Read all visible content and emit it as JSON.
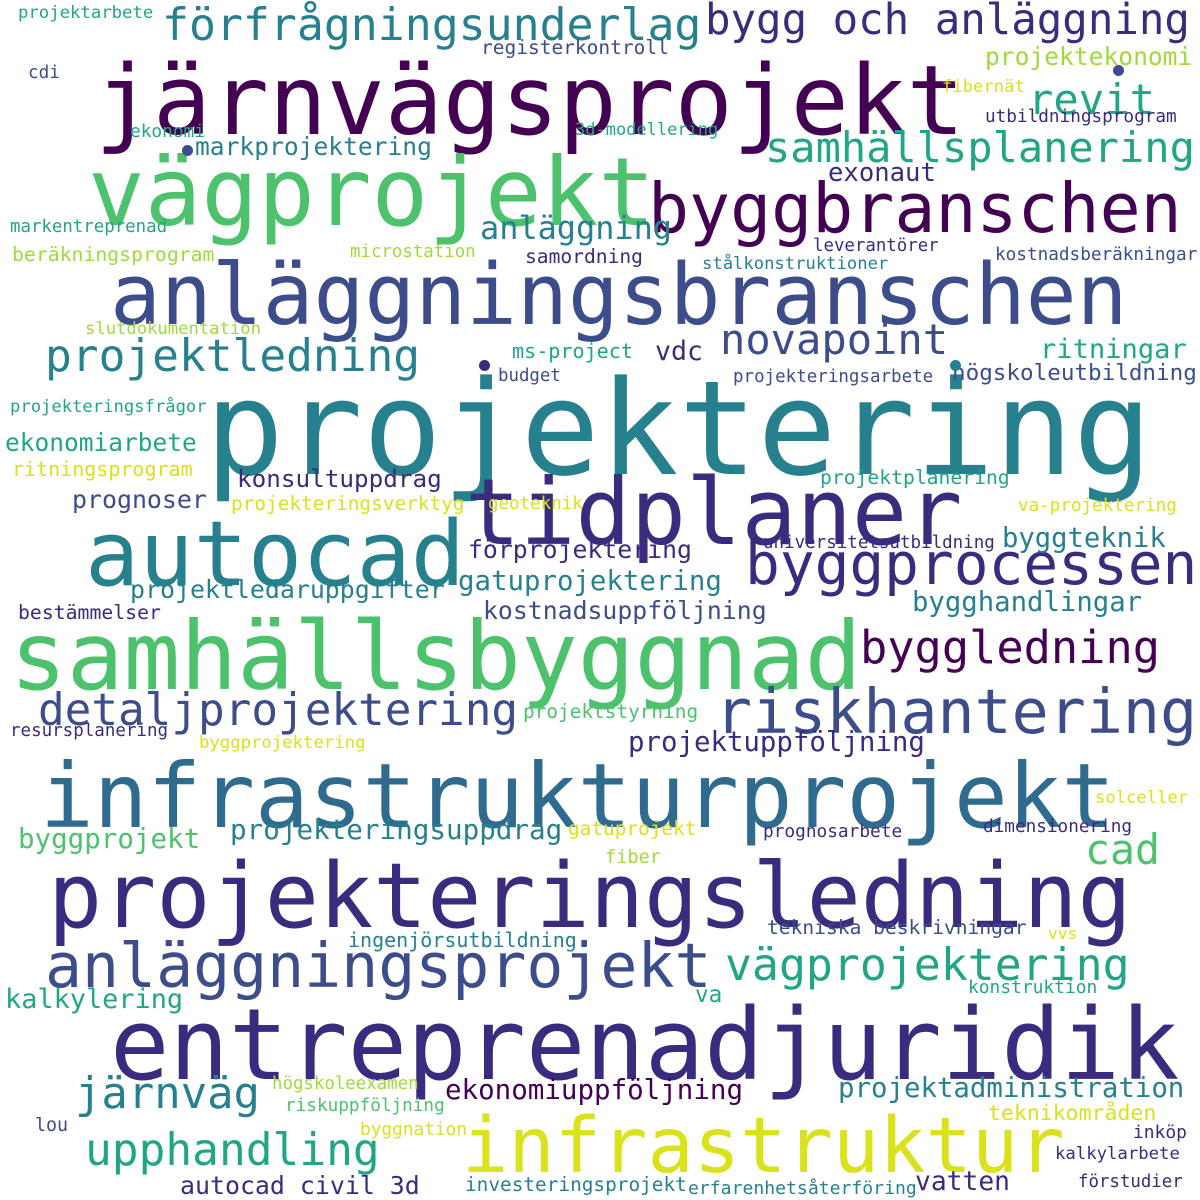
{
  "palette": {
    "dark_purple": "#440154",
    "indigo": "#3b2b7f",
    "slate_blue": "#3d4c8a",
    "steel_blue": "#2f6b8e",
    "teal": "#27808e",
    "sea_green": "#21a685",
    "green": "#4cc26c",
    "lime": "#a2d93a",
    "yellow": "#d9e21a"
  },
  "words": [
    {
      "text": "projektering"
    },
    {
      "text": "järnvägsprojekt"
    },
    {
      "text": "vägprojekt"
    },
    {
      "text": "anläggningsbranschen"
    },
    {
      "text": "samhällsbyggnad"
    },
    {
      "text": "infrastrukturprojekt"
    },
    {
      "text": "projekteringsledning"
    },
    {
      "text": "entreprenadjuridik"
    },
    {
      "text": "infrastruktur"
    },
    {
      "text": "autocad"
    },
    {
      "text": "tidplaner"
    },
    {
      "text": "byggbranschen"
    },
    {
      "text": "byggprocessen"
    },
    {
      "text": "riskhantering"
    },
    {
      "text": "anläggningsprojekt"
    },
    {
      "text": "förfrågningsunderlag"
    },
    {
      "text": "bygg och anläggning"
    },
    {
      "text": "byggledning"
    },
    {
      "text": "detaljprojektering"
    },
    {
      "text": "samhällsplanering"
    },
    {
      "text": "vägprojektering"
    },
    {
      "text": "upphandling"
    },
    {
      "text": "projektledning"
    },
    {
      "text": "novapoint"
    },
    {
      "text": "järnväg"
    },
    {
      "text": "revit"
    },
    {
      "text": "cad"
    },
    {
      "text": "anläggning"
    },
    {
      "text": "markprojektering"
    },
    {
      "text": "projekteringsuppdrag"
    },
    {
      "text": "ekonomiuppföljning"
    },
    {
      "text": "projektadministration"
    },
    {
      "text": "gatuprojektering"
    },
    {
      "text": "projektuppföljning"
    },
    {
      "text": "byggprojekt"
    },
    {
      "text": "kalkylering"
    },
    {
      "text": "autocad civil 3d"
    },
    {
      "text": "projektledaruppgifter"
    },
    {
      "text": "förprojektering"
    },
    {
      "text": "bygghandlingar"
    },
    {
      "text": "ritningar"
    },
    {
      "text": "exonaut"
    },
    {
      "text": "beräkningsprogram"
    },
    {
      "text": "projektekonomi"
    },
    {
      "text": "ekonomiarbete"
    },
    {
      "text": "konsultuppdrag"
    },
    {
      "text": "byggteknik"
    },
    {
      "text": "kostnadsuppföljning"
    },
    {
      "text": "prognoser"
    },
    {
      "text": "ritningsprogram"
    },
    {
      "text": "vdc"
    },
    {
      "text": "teknikområden"
    },
    {
      "text": "vatten"
    },
    {
      "text": "ingenjörsutbildning"
    },
    {
      "text": "tekniska beskrivningar"
    },
    {
      "text": "investeringsprojekt"
    },
    {
      "text": "ms-project"
    },
    {
      "text": "samordning"
    },
    {
      "text": "registerkontroll"
    },
    {
      "text": "projektarbete"
    },
    {
      "text": "cdi"
    },
    {
      "text": "fibernät"
    },
    {
      "text": "3d-modellering"
    },
    {
      "text": "utbildningsprogram"
    },
    {
      "text": "ekonomi"
    },
    {
      "text": "markentreprenad"
    },
    {
      "text": "microstation"
    },
    {
      "text": "leverantörer"
    },
    {
      "text": "stålkonstruktioner"
    },
    {
      "text": "kostnadsberäkningar"
    },
    {
      "text": "slutdokumentation"
    },
    {
      "text": "budget"
    },
    {
      "text": "projekteringsarbete"
    },
    {
      "text": "högskoleutbildning"
    },
    {
      "text": "projekteringsfrågor"
    },
    {
      "text": "projektplanering"
    },
    {
      "text": "projekteringsverktyg"
    },
    {
      "text": "geoteknik"
    },
    {
      "text": "va-projektering"
    },
    {
      "text": "universitetsutbildning"
    },
    {
      "text": "bestämmelser"
    },
    {
      "text": "projektstyrning"
    },
    {
      "text": "resursplanering"
    },
    {
      "text": "byggprojektering"
    },
    {
      "text": "solceller"
    },
    {
      "text": "gatuprojekt"
    },
    {
      "text": "prognosarbete"
    },
    {
      "text": "dimensionering"
    },
    {
      "text": "fiber"
    },
    {
      "text": "vvs"
    },
    {
      "text": "va"
    },
    {
      "text": "konstruktion"
    },
    {
      "text": "högskoleexamen"
    },
    {
      "text": "riskuppföljning"
    },
    {
      "text": "lou"
    },
    {
      "text": "byggnation"
    },
    {
      "text": "inköp"
    },
    {
      "text": "kalkylarbete"
    },
    {
      "text": "erfarenhetsåterföring"
    },
    {
      "text": "förstudier"
    }
  ]
}
